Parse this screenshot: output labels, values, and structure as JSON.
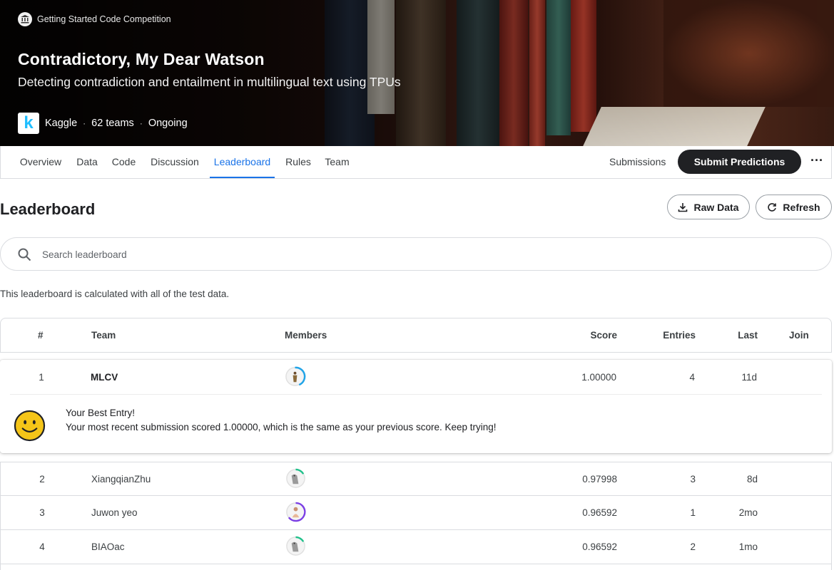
{
  "banner": {
    "competition_type": "Getting Started Code Competition",
    "title": "Contradictory, My Dear Watson",
    "subtitle": "Detecting contradiction and entailment in multilingual text using TPUs",
    "host": "Kaggle",
    "teams": "62 teams",
    "status": "Ongoing",
    "host_logo_letter": "k"
  },
  "nav": {
    "tabs": [
      "Overview",
      "Data",
      "Code",
      "Discussion",
      "Leaderboard",
      "Rules",
      "Team"
    ],
    "active_tab": "Leaderboard",
    "submissions_label": "Submissions",
    "submit_label": "Submit Predictions",
    "more_label": "···"
  },
  "leaderboard": {
    "title": "Leaderboard",
    "raw_data_label": "Raw Data",
    "refresh_label": "Refresh",
    "search_placeholder": "Search leaderboard",
    "note": "This leaderboard is calculated with all of the test data.",
    "columns": [
      "#",
      "Team",
      "Members",
      "Score",
      "Entries",
      "Last",
      "Join"
    ],
    "rows": [
      {
        "rank": "1",
        "team": "MLCV",
        "score": "1.00000",
        "entries": "4",
        "last": "11d",
        "avatar": "person-standing-avatar",
        "ring_color": "#20a4e8",
        "ring_fraction": 0.45
      },
      {
        "rank": "2",
        "team": "XiangqianZhu",
        "score": "0.97998",
        "entries": "3",
        "last": "8d",
        "avatar": "duck-avatar",
        "ring_color": "#1fc08a",
        "ring_fraction": 0.2
      },
      {
        "rank": "3",
        "team": "Juwon yeo",
        "score": "0.96592",
        "entries": "1",
        "last": "2mo",
        "avatar": "person-sitting-avatar",
        "ring_color": "#7b3fe4",
        "ring_fraction": 0.55
      },
      {
        "rank": "4",
        "team": "BIAOac",
        "score": "0.96592",
        "entries": "2",
        "last": "1mo",
        "avatar": "duck-avatar",
        "ring_color": "#1fc08a",
        "ring_fraction": 0.2
      }
    ],
    "best_entry": {
      "title": "Your Best Entry!",
      "message": "Your most recent submission scored 1.00000, which is the same as your previous score. Keep trying!"
    }
  },
  "colors": {
    "accent": "#1a73e8",
    "submit_bg": "#202124",
    "smile_yellow": "#f5c518"
  }
}
